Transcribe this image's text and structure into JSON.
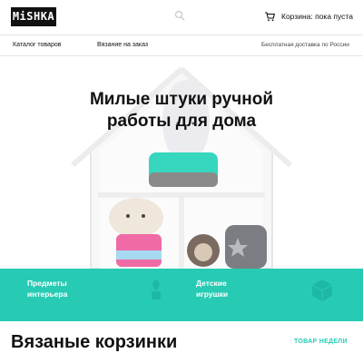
{
  "header": {
    "logo_text": "MiSHKA",
    "cart_label": "Корзина: пока пуста",
    "search_icon": "search-icon",
    "cart_icon": "cart-icon"
  },
  "nav": {
    "catalog": "Каталог товаров",
    "custom_knitting": "Вязание на заказ",
    "delivery": "Бесплатная доставка по России"
  },
  "hero": {
    "title_line1": "Милые штуки ручной",
    "title_line2": "работы для дома"
  },
  "band": {
    "decor_line1": "Предметы",
    "decor_line2": "интерьера",
    "toys_line1": "Детские",
    "toys_line2": "игрушки",
    "color": "#27cbb4"
  },
  "section": {
    "title": "Вязаные корзинки",
    "link": "ТОВАР НЕДЕЛИ"
  }
}
